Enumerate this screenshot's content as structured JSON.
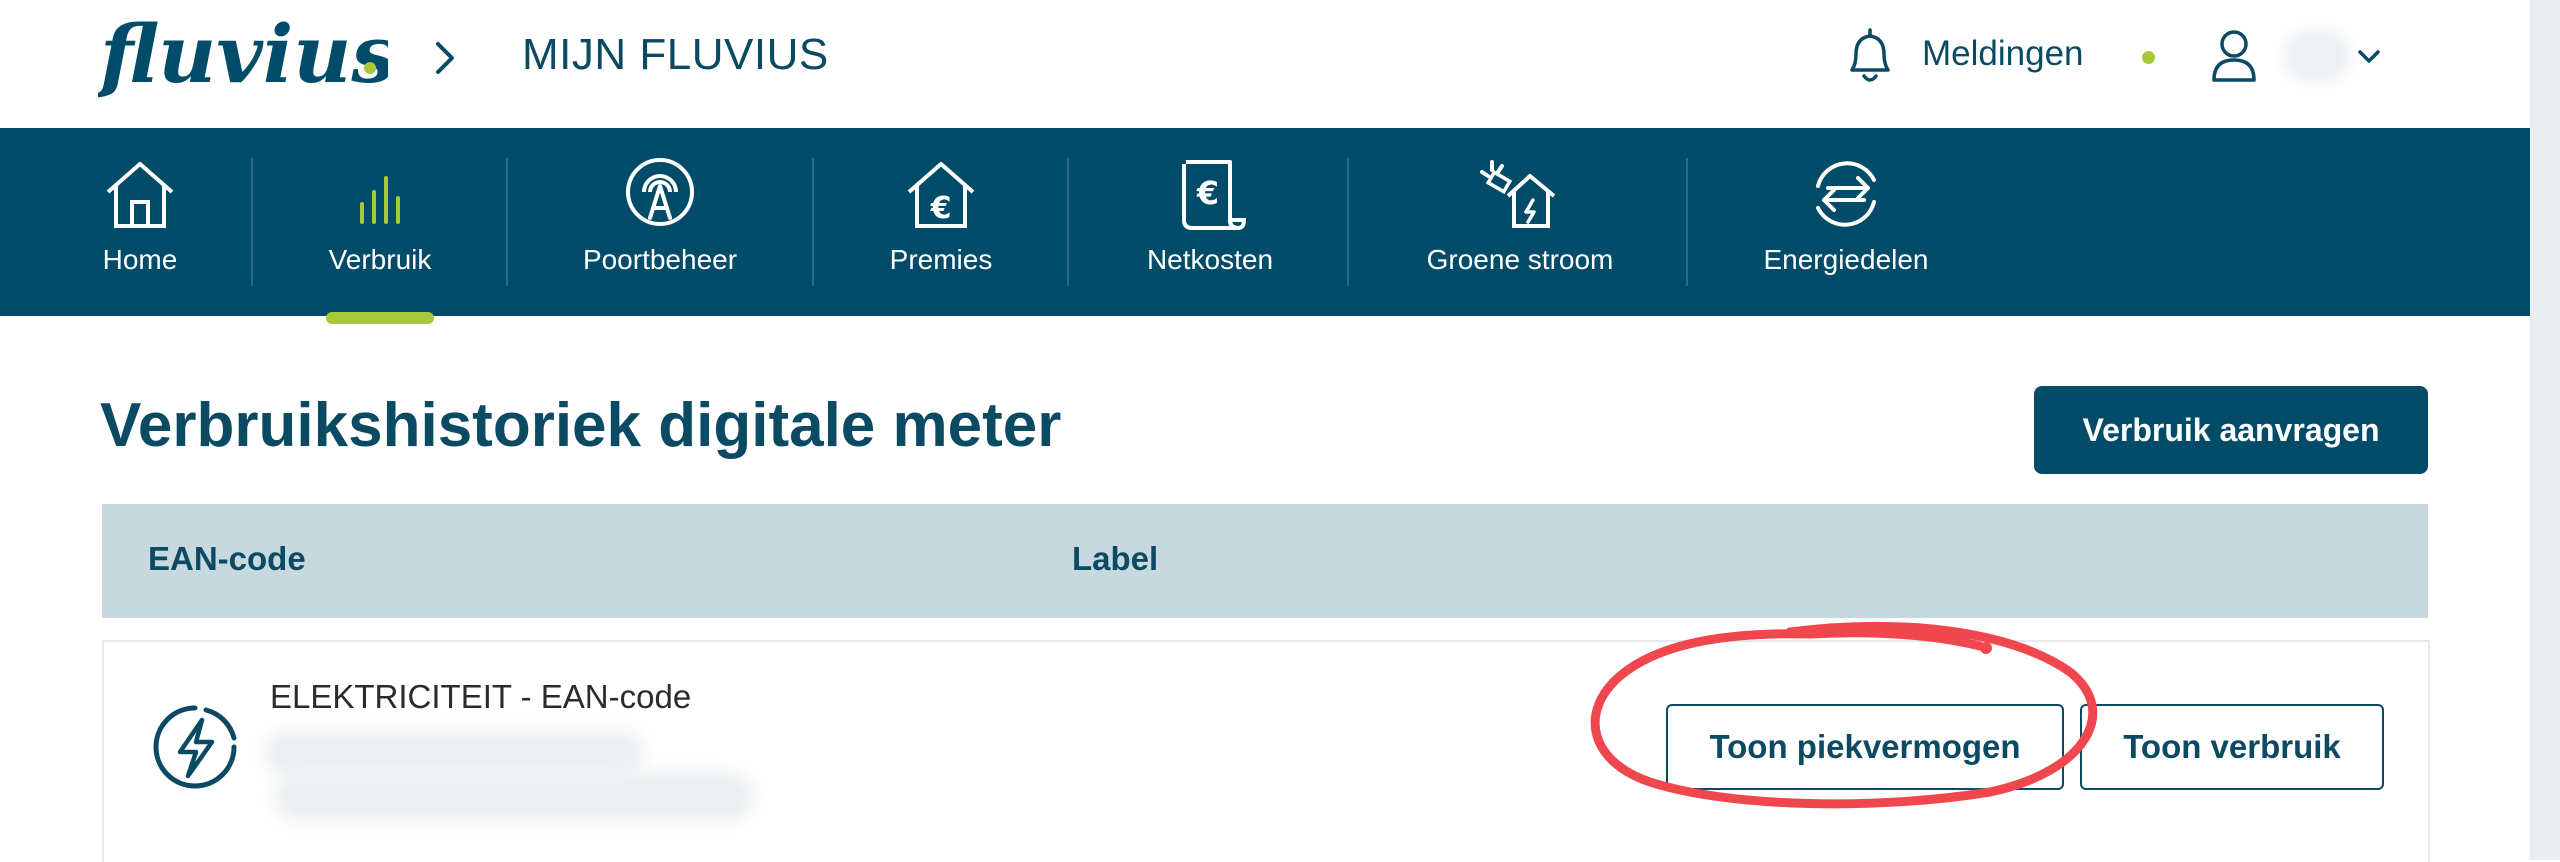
{
  "brand": {
    "logo_text": "fluvius"
  },
  "header": {
    "breadcrumb": "MIJN FLUVIUS",
    "notifications_label": "Meldingen",
    "status_dot_color": "#a8c83a",
    "icons": [
      "fluvius-logo",
      "chevron-right-icon",
      "bell-icon",
      "user-icon",
      "chevron-down-icon"
    ]
  },
  "nav": {
    "active": "Verbruik",
    "items": [
      {
        "label": "Home",
        "icon": "house-icon"
      },
      {
        "label": "Verbruik",
        "icon": "bar-chart-icon"
      },
      {
        "label": "Poortbeheer",
        "icon": "antenna-icon"
      },
      {
        "label": "Premies",
        "icon": "house-euro-icon"
      },
      {
        "label": "Netkosten",
        "icon": "euro-scroll-icon"
      },
      {
        "label": "Groene stroom",
        "icon": "solar-house-icon"
      },
      {
        "label": "Energiedelen",
        "icon": "exchange-arrows-icon"
      }
    ]
  },
  "main": {
    "title": "Verbruikshistoriek digitale meter",
    "request_button": "Verbruik aanvragen",
    "table": {
      "headers": [
        "EAN-code",
        "Label"
      ],
      "rows": [
        {
          "title": "ELEKTRICITEIT - EAN-code",
          "icon": "lightning-icon",
          "buttons": [
            "Toon piekvermogen",
            "Toon verbruik"
          ]
        }
      ]
    }
  },
  "colors": {
    "primary": "#034c69",
    "text": "#0b4a63",
    "accent": "#a8c83a",
    "table_header": "#c8d8df",
    "annotation": "#f0474f"
  }
}
